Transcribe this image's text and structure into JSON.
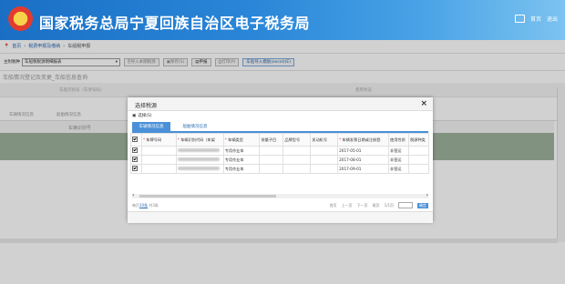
{
  "header": {
    "title": "国家税务总局宁夏回族自治区电子税务局",
    "link_home": "首页",
    "link_logout": "退出"
  },
  "breadcrumb": [
    "首页",
    "税费申报及缴纳",
    "车船税申报"
  ],
  "toolbar": {
    "type_label": "主附税种",
    "type_value": "车船税税源明细报表",
    "import_btn": "导入本期税源",
    "save_btn": "保存(S)",
    "declare_btn": "申报",
    "print_btn": "打印(P)",
    "excel_btn": "车船导入模板(excel)(E)"
  },
  "background": {
    "section_title": "车船情况登记及变更_车船信息查询",
    "label_left": "车船识别号（车架号码）",
    "label_right": "使用状态",
    "subtab1": "车辆情况信息",
    "subtab2": "船舶情况信息",
    "col_header": "车辆识别号"
  },
  "dialog": {
    "title": "选择税源",
    "select_label": "选择(S)",
    "tabs": [
      "车辆情况信息",
      "船舶情况信息"
    ],
    "columns": [
      "车牌号码",
      "车辆识别代码（车架",
      "车辆类型",
      "排量子目",
      "品牌型号",
      "发动机号",
      "车辆发票日期或注册登",
      "使用性质",
      "税源种类"
    ],
    "required_cols": [
      0,
      1,
      2,
      6
    ],
    "rows": [
      {
        "plate": "",
        "vin": "",
        "type": "专用作业车",
        "sub": "",
        "brand": "",
        "engine": "",
        "date": "2017-05-01",
        "usage": "非营运",
        "kind": ""
      },
      {
        "plate": "",
        "vin": "",
        "type": "专用作业车",
        "sub": "",
        "brand": "",
        "engine": "",
        "date": "2017-08-01",
        "usage": "非营运",
        "kind": ""
      },
      {
        "plate": "",
        "vin": "",
        "type": "专用作业车",
        "sub": "",
        "brand": "",
        "engine": "",
        "date": "2017-09-01",
        "usage": "非营运",
        "kind": ""
      }
    ],
    "pager": {
      "per_page_prefix": "每页",
      "per_page_value": "10条",
      "total": "共3条",
      "first": "首页",
      "prev": "上一页",
      "next": "下一页",
      "last": "尾页",
      "page_info": "1/1页",
      "go": "确定"
    }
  }
}
